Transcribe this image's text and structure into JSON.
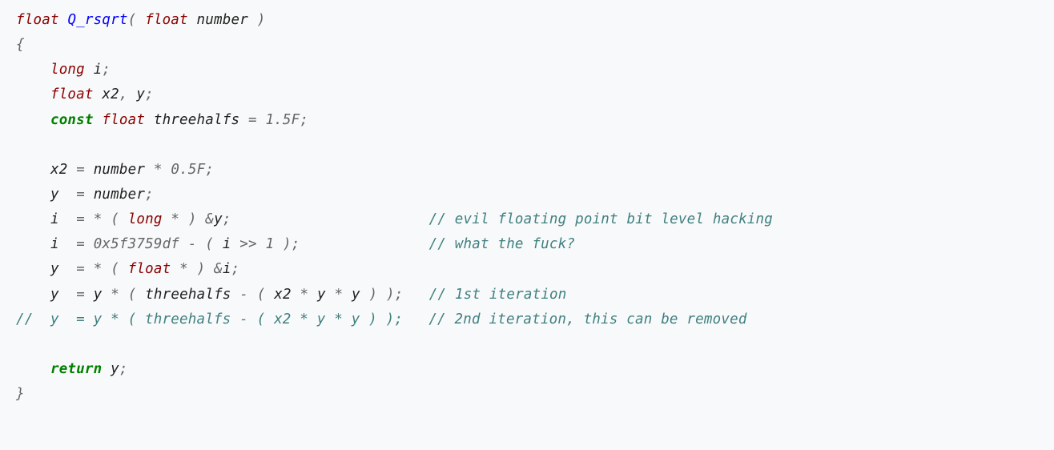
{
  "code": {
    "line1_float": "float",
    "line1_fn": "Q_rsqrt",
    "line1_open": "(",
    "line1_ptype": "float",
    "line1_param": "number",
    "line1_close": ")",
    "line2_brace": "{",
    "indent": "    ",
    "line3_long": "long",
    "line3_i": "i",
    "line3_semi": ";",
    "line4_float": "float",
    "line4_x2": "x2",
    "line4_comma": ",",
    "line4_y": "y",
    "line4_semi": ";",
    "line5_const": "const",
    "line5_float": "float",
    "line5_name": "threehalfs",
    "line5_eq": "=",
    "line5_val": "1.5F",
    "line5_semi": ";",
    "line7_lhs": "x2",
    "line7_eq": "=",
    "line7_rhs1": "number",
    "line7_star": "*",
    "line7_rhs2": "0.5F",
    "line7_semi": ";",
    "line8_lhs": "y ",
    "line8_eq": "=",
    "line8_rhs": "number",
    "line8_semi": ";",
    "line9_lhs": "i ",
    "line9_eq": "=",
    "line9_star1": "*",
    "line9_open": "(",
    "line9_long": "long",
    "line9_star2": "*",
    "line9_close": ")",
    "line9_amp": "&",
    "line9_y": "y",
    "line9_semi": ";",
    "line9_pad": "                       ",
    "line9_cmt": "// evil floating point bit level hacking",
    "line10_lhs": "i ",
    "line10_eq": "=",
    "line10_hex": "0x5f3759df",
    "line10_minus": "-",
    "line10_open": "(",
    "line10_i": "i",
    "line10_shift": ">>",
    "line10_one": "1",
    "line10_close": ")",
    "line10_semi": ";",
    "line10_pad": "               ",
    "line10_cmt": "// what the fuck?",
    "line11_lhs": "y ",
    "line11_eq": "=",
    "line11_star1": "*",
    "line11_open": "(",
    "line11_float": "float",
    "line11_star2": "*",
    "line11_close": ")",
    "line11_amp": "&",
    "line11_i": "i",
    "line11_semi": ";",
    "line12_lhs": "y ",
    "line12_eq": "=",
    "line12_y": "y",
    "line12_star1": "*",
    "line12_open1": "(",
    "line12_th": "threehalfs",
    "line12_minus": "-",
    "line12_open2": "(",
    "line12_x2": "x2",
    "line12_star2": "*",
    "line12_y2": "y",
    "line12_star3": "*",
    "line12_y3": "y",
    "line12_close2": ")",
    "line12_close1": ")",
    "line12_semi": ";",
    "line12_pad": "   ",
    "line12_cmt": "// 1st iteration",
    "line13_full": "//  y  = y * ( threehalfs - ( x2 * y * y ) );   // 2nd iteration, this can be removed",
    "line15_return": "return",
    "line15_y": "y",
    "line15_semi": ";",
    "line16_brace": "}"
  }
}
